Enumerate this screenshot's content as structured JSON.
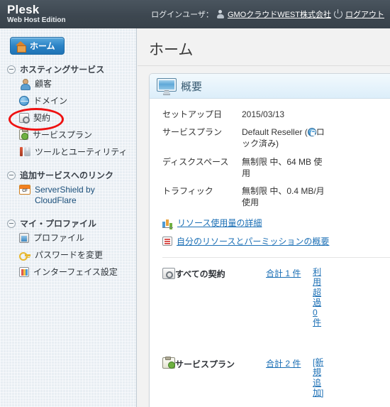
{
  "header": {
    "brand_name": "Plesk",
    "brand_sub": "Web Host Edition",
    "login_label": "ログインユーザ：",
    "user_icon": "user-icon",
    "user_name": "GMOクラウドWEST株式会社",
    "power_icon": "power-icon",
    "logout_label": "ログアウト"
  },
  "sidebar": {
    "home_button": {
      "label": "ホーム",
      "icon": "home-icon"
    },
    "sections": [
      {
        "title": "ホスティングサービス",
        "toggle_icon": "collapse-minus-icon",
        "items": [
          {
            "label": "顧客",
            "icon": "customer-icon"
          },
          {
            "label": "ドメイン",
            "icon": "globe-icon"
          },
          {
            "label": "契約",
            "icon": "subscription-icon"
          },
          {
            "label": "サービスプラン",
            "icon": "service-plan-icon"
          },
          {
            "label": "ツールとユーティリティ",
            "icon": "tools-icon"
          }
        ]
      },
      {
        "title": "追加サービスへのリンク",
        "toggle_icon": "collapse-minus-icon",
        "items": [
          {
            "label": "ServerShield by CloudFlare",
            "icon": "cloudflare-icon"
          }
        ]
      },
      {
        "title": "マイ・プロファイル",
        "toggle_icon": "collapse-minus-icon",
        "items": [
          {
            "label": "プロファイル",
            "icon": "profile-icon"
          },
          {
            "label": "パスワードを変更",
            "icon": "key-icon"
          },
          {
            "label": "インターフェイス設定",
            "icon": "interface-settings-icon"
          }
        ]
      }
    ]
  },
  "main": {
    "page_title": "ホーム",
    "panel": {
      "icon": "monitor-icon",
      "title": "概要",
      "rows": [
        {
          "key": "セットアップ日",
          "value": "2015/03/13"
        },
        {
          "key": "サービスプラン",
          "value_prefix": "Default Reseller (",
          "value_badge": "lock-icon",
          "value_suffix": "ロック済み)"
        },
        {
          "key": "ディスクスペース",
          "value": "無制限 中、64 MB 使用"
        },
        {
          "key": "トラフィック",
          "value": "無制限 中、0.4 MB/月 使用"
        }
      ],
      "links": [
        {
          "label": "リソース使用量の詳細",
          "icon": "bar-chart-icon"
        },
        {
          "label": "自分のリソースとパーミッションの概要",
          "icon": "list-icon"
        }
      ],
      "stats": [
        {
          "icon": "subscription-icon",
          "name": "すべての契約",
          "count_label": "合計 1 件",
          "extra_label": "利用超過 0 件"
        },
        {
          "icon": "service-plan-icon",
          "name": "サービスプラン",
          "count_label": "合計 2 件",
          "extra_label": "[新規追加]"
        }
      ]
    }
  },
  "annotation": {
    "shape": "red-ellipse",
    "color": "#ee1111",
    "target": "契約"
  }
}
